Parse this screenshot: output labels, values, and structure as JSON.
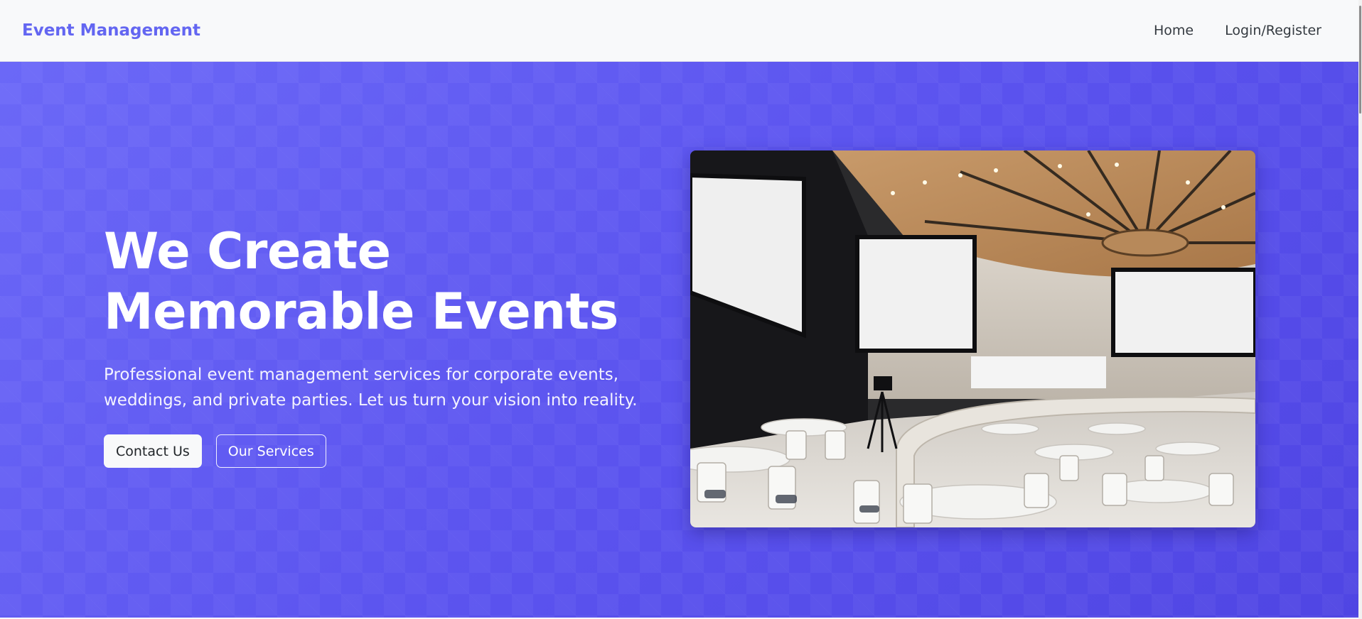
{
  "navbar": {
    "brand": "Event Management",
    "links": [
      {
        "label": "Home"
      },
      {
        "label": "Login/Register"
      }
    ]
  },
  "hero": {
    "title": "We Create Memorable Events",
    "subtitle": "Professional event management services for corporate events, weddings, and private parties. Let us turn your vision into reality.",
    "buttons": {
      "primary": "Contact Us",
      "secondary": "Our Services"
    },
    "image_icon": "conference-hall-photo"
  },
  "colors": {
    "brand": "#6366f1",
    "hero_gradient_start": "#6b68f7",
    "hero_gradient_end": "#4f45e3",
    "nav_bg": "#f8f9fa",
    "nav_text": "#343a40"
  }
}
